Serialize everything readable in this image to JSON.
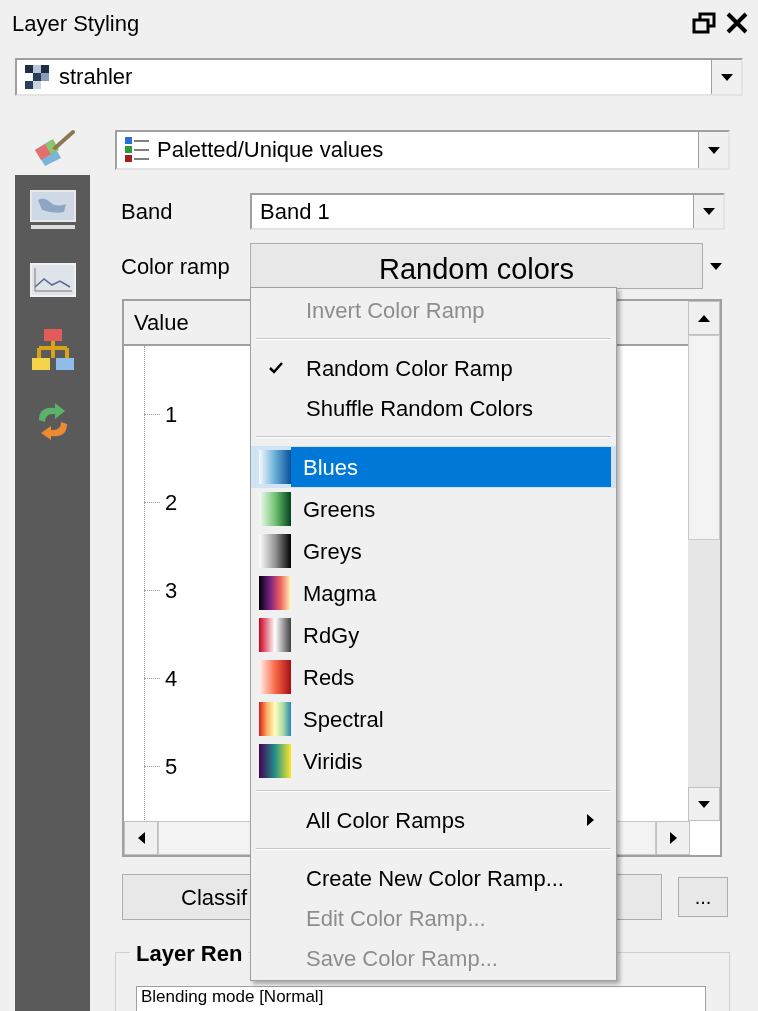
{
  "window": {
    "title": "Layer Styling"
  },
  "layer_select": {
    "value": "strahler"
  },
  "side_tabs": [
    {
      "kind": "symbology",
      "selected": true
    },
    {
      "kind": "transparency",
      "selected": false
    },
    {
      "kind": "histogram",
      "selected": false
    },
    {
      "kind": "rendering",
      "selected": false
    },
    {
      "kind": "history",
      "selected": false
    }
  ],
  "renderer_select": {
    "value": "Paletted/Unique values"
  },
  "band": {
    "label": "Band",
    "value": "Band 1"
  },
  "color_ramp": {
    "label": "Color ramp",
    "value": "Random colors"
  },
  "table": {
    "columns": [
      "Value"
    ],
    "rows": [
      "1",
      "2",
      "3",
      "4",
      "5"
    ]
  },
  "classify_button": "Classif",
  "more_button": "...",
  "group": {
    "title": "Layer Ren",
    "blending": "Blending mode [Normal]"
  },
  "menu": [
    {
      "kind": "action",
      "label": "Invert Color Ramp",
      "disabled": true,
      "checked": false
    },
    {
      "kind": "separator"
    },
    {
      "kind": "action",
      "label": "Random Color Ramp",
      "disabled": false,
      "checked": true
    },
    {
      "kind": "action",
      "label": "Shuffle Random Colors",
      "disabled": false,
      "checked": false
    },
    {
      "kind": "separator"
    },
    {
      "kind": "ramp",
      "label": "Blues",
      "selected": true
    },
    {
      "kind": "ramp",
      "label": "Greens",
      "selected": false
    },
    {
      "kind": "ramp",
      "label": "Greys",
      "selected": false
    },
    {
      "kind": "ramp",
      "label": "Magma",
      "selected": false
    },
    {
      "kind": "ramp",
      "label": "RdGy",
      "selected": false
    },
    {
      "kind": "ramp",
      "label": "Reds",
      "selected": false
    },
    {
      "kind": "ramp",
      "label": "Spectral",
      "selected": false
    },
    {
      "kind": "ramp",
      "label": "Viridis",
      "selected": false
    },
    {
      "kind": "separator"
    },
    {
      "kind": "submenu",
      "label": "All Color Ramps"
    },
    {
      "kind": "separator"
    },
    {
      "kind": "action",
      "label": "Create New Color Ramp...",
      "disabled": false,
      "checked": false
    },
    {
      "kind": "action",
      "label": "Edit Color Ramp...",
      "disabled": true,
      "checked": false
    },
    {
      "kind": "action",
      "label": "Save Color Ramp...",
      "disabled": true,
      "checked": false
    }
  ]
}
